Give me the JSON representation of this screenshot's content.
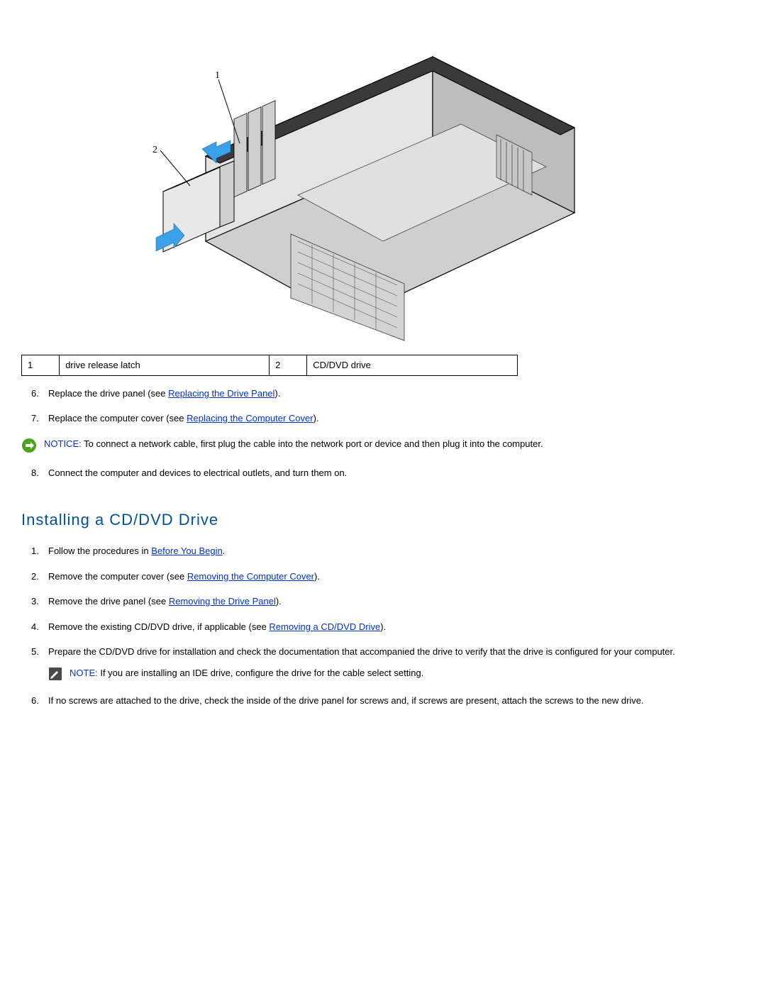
{
  "diagram": {
    "callout1_number": "1",
    "callout2_number": "2"
  },
  "callout_table": {
    "r1c1": "1",
    "r1c2": "drive release latch",
    "r1c3": "2",
    "r1c4": "CD/DVD drive"
  },
  "steps_top": {
    "s6_num": "6.",
    "s6_a": "Replace the drive panel (see ",
    "s6_link": "Replacing the Drive Panel",
    "s6_b": ").",
    "s7_num": "7.",
    "s7_a": "Replace the computer cover (see ",
    "s7_link": "Replacing the Computer Cover",
    "s7_b": ").",
    "s8_num": "8.",
    "s8_text": "Connect the computer and devices to electrical outlets, and turn them on."
  },
  "notice": {
    "label": "NOTICE:",
    "text": " To connect a network cable, first plug the cable into the network port or device and then plug it into the computer."
  },
  "section_title": "Installing a CD/DVD Drive",
  "steps_install": {
    "s1_num": "1.",
    "s1_a": "Follow the procedures in ",
    "s1_link": "Before You Begin",
    "s1_b": ".",
    "s2_num": "2.",
    "s2_a": "Remove the computer cover (see ",
    "s2_link": "Removing the Computer Cover",
    "s2_b": ").",
    "s3_num": "3.",
    "s3_a": "Remove the drive panel (see ",
    "s3_link": "Removing the Drive Panel",
    "s3_b": ").",
    "s4_num": "4.",
    "s4_a": "Remove the existing CD/DVD drive, if applicable (see ",
    "s4_link": "Removing a CD/DVD Drive",
    "s4_b": ").",
    "s5_num": "5.",
    "s5_text": "Prepare the CD/DVD drive for installation and check the documentation that accompanied the drive to verify that the drive is configured for your computer.",
    "s6_num": "6.",
    "s6_text": "If no screws are attached to the drive, check the inside of the drive panel for screws and, if screws are present, attach the screws to the new drive."
  },
  "note": {
    "label": "NOTE:",
    "text": " If you are installing an IDE drive, configure the drive for the cable select setting."
  }
}
